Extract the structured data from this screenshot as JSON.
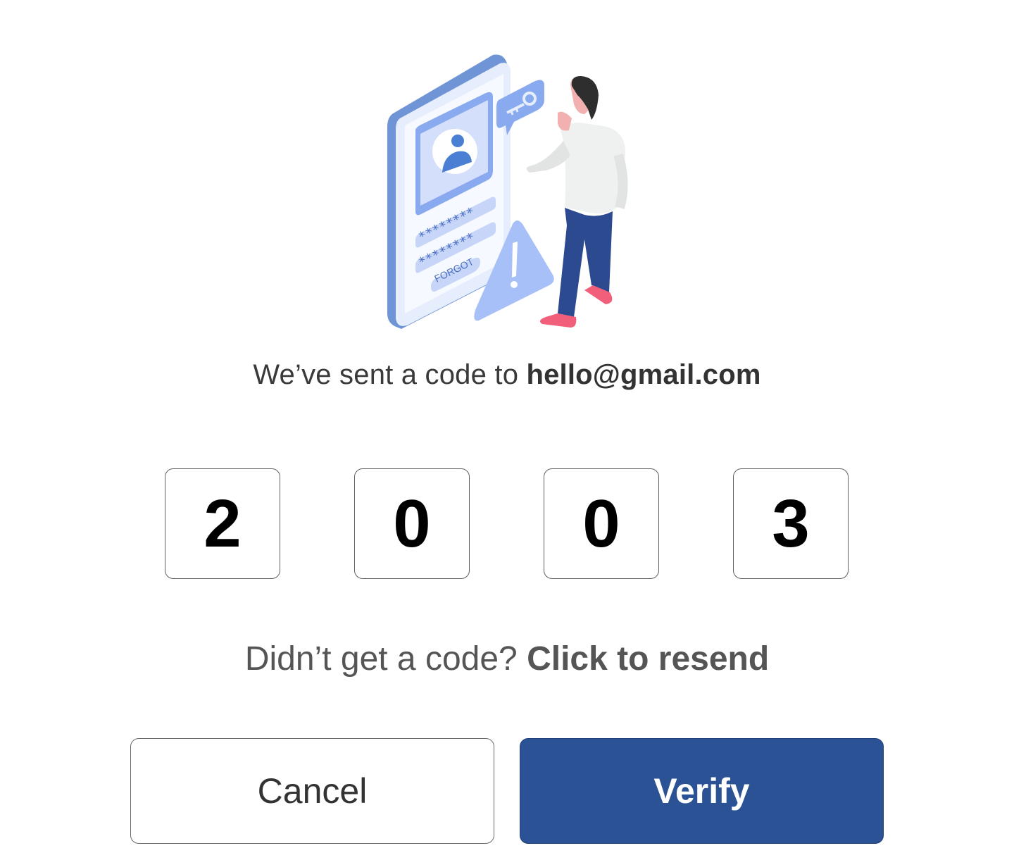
{
  "message": {
    "prefix": "We’ve sent a code to ",
    "email": "hello@gmail.com"
  },
  "code": {
    "digits": [
      "2",
      "0",
      "0",
      "3"
    ]
  },
  "resend": {
    "prompt": "Didn’t get a code? ",
    "link_label": "Click to resend"
  },
  "actions": {
    "cancel_label": "Cancel",
    "verify_label": "Verify"
  },
  "illustration": {
    "password_fields": [
      "********",
      "********"
    ],
    "forgot_label": "FORGOT"
  },
  "colors": {
    "primary": "#2b5294",
    "illustration_blue": "#6f95d6",
    "illustration_light": "#dce6fb",
    "accent_pink": "#f25f7a"
  }
}
